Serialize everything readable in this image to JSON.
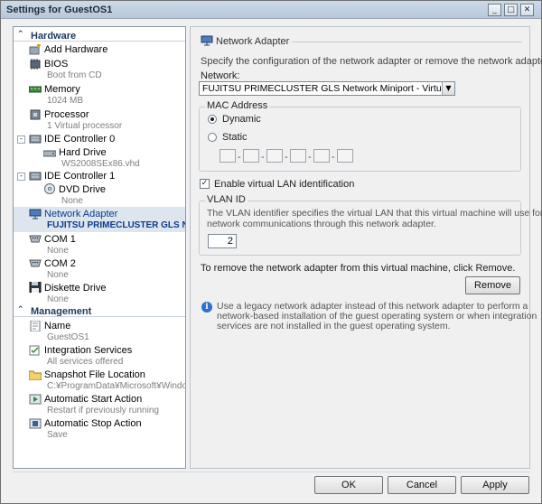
{
  "window": {
    "title": "Settings for GuestOS1",
    "buttons": {
      "minimize": "_",
      "maximize": "□",
      "close": "✕"
    }
  },
  "sidebar": {
    "hardware_label": "Hardware",
    "management_label": "Management",
    "collapse_glyph": "⌃",
    "items": [
      {
        "name": "Add Hardware",
        "sub": ""
      },
      {
        "name": "BIOS",
        "sub": "Boot from CD"
      },
      {
        "name": "Memory",
        "sub": "1024 MB"
      },
      {
        "name": "Processor",
        "sub": "1 Virtual processor"
      },
      {
        "name": "IDE Controller 0",
        "sub": ""
      },
      {
        "name": "Hard Drive",
        "sub": "WS2008SEx86.vhd"
      },
      {
        "name": "IDE Controller 1",
        "sub": ""
      },
      {
        "name": "DVD Drive",
        "sub": "None"
      },
      {
        "name": "Network Adapter",
        "sub": "FUJITSU PRIMECLUSTER GLS N..."
      },
      {
        "name": "COM 1",
        "sub": "None"
      },
      {
        "name": "COM 2",
        "sub": "None"
      },
      {
        "name": "Diskette Drive",
        "sub": "None"
      }
    ],
    "management_items": [
      {
        "name": "Name",
        "sub": "GuestOS1"
      },
      {
        "name": "Integration Services",
        "sub": "All services offered"
      },
      {
        "name": "Snapshot File Location",
        "sub": "C:¥ProgramData¥Microsoft¥Windo..."
      },
      {
        "name": "Automatic Start Action",
        "sub": "Restart if previously running"
      },
      {
        "name": "Automatic Stop Action",
        "sub": "Save"
      }
    ]
  },
  "panel": {
    "title": "Network Adapter",
    "description": "Specify the configuration of the network adapter or remove the network adapter.",
    "network_label": "Network:",
    "network_value": "FUJITSU PRIMECLUSTER GLS Network Miniport - Virtual Network",
    "mac_group_label": "MAC Address",
    "mac_dynamic": "Dynamic",
    "mac_static": "Static",
    "mac_dash": "-",
    "vlan_checkbox_label": "Enable virtual LAN identification",
    "vlan_checked": "✓",
    "vlan_group_label": "VLAN ID",
    "vlan_desc_1": "The VLAN identifier specifies the virtual LAN that this virtual machine will use for all",
    "vlan_desc_2": "network communications through this network adapter.",
    "vlan_value": "2",
    "remove_hint": "To remove the network adapter from this virtual machine, click Remove.",
    "remove_button": "Remove",
    "info_icon": "i",
    "info_1": "Use a legacy network adapter instead of this network adapter to perform a",
    "info_2": "network-based installation of the guest operating system or when integration",
    "info_3": "services are not installed in the guest operating system."
  },
  "footer": {
    "ok": "OK",
    "cancel": "Cancel",
    "apply": "Apply"
  },
  "colors": {
    "selected_bg": "#dde5ef",
    "section_text": "#1d3a5e",
    "info_blue": "#2f6fd0"
  }
}
